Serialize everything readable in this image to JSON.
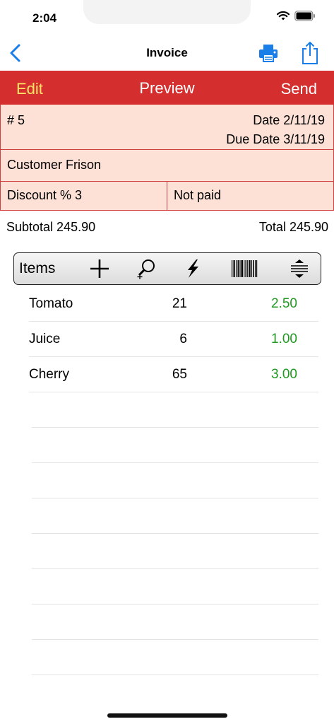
{
  "status_bar": {
    "time": "2:04"
  },
  "nav": {
    "title": "Invoice"
  },
  "action_bar": {
    "edit": "Edit",
    "preview": "Preview",
    "send": "Send"
  },
  "invoice": {
    "number": "# 5",
    "date": "Date 2/11/19",
    "due_date": "Due Date 3/11/19",
    "customer": "Customer Frison",
    "discount": "Discount % 3",
    "paid_status": "Not paid"
  },
  "totals": {
    "subtotal": "Subtotal 245.90",
    "total": "Total 245.90"
  },
  "toolbar": {
    "label": "Items",
    "icons": [
      "plus-icon",
      "search-plus-icon",
      "lightning-icon",
      "barcode-icon",
      "sort-icon"
    ]
  },
  "items": [
    {
      "name": "Tomato",
      "qty": "21",
      "price": "2.50"
    },
    {
      "name": "Juice",
      "qty": "6",
      "price": "1.00"
    },
    {
      "name": "Cherry",
      "qty": "65",
      "price": "3.00"
    }
  ],
  "colors": {
    "accent_blue": "#1a7ee8",
    "bar_red": "#d52e2e",
    "edit_yellow": "#ffe566",
    "panel_pink": "#fde1d7",
    "price_green": "#1f9a1f"
  }
}
